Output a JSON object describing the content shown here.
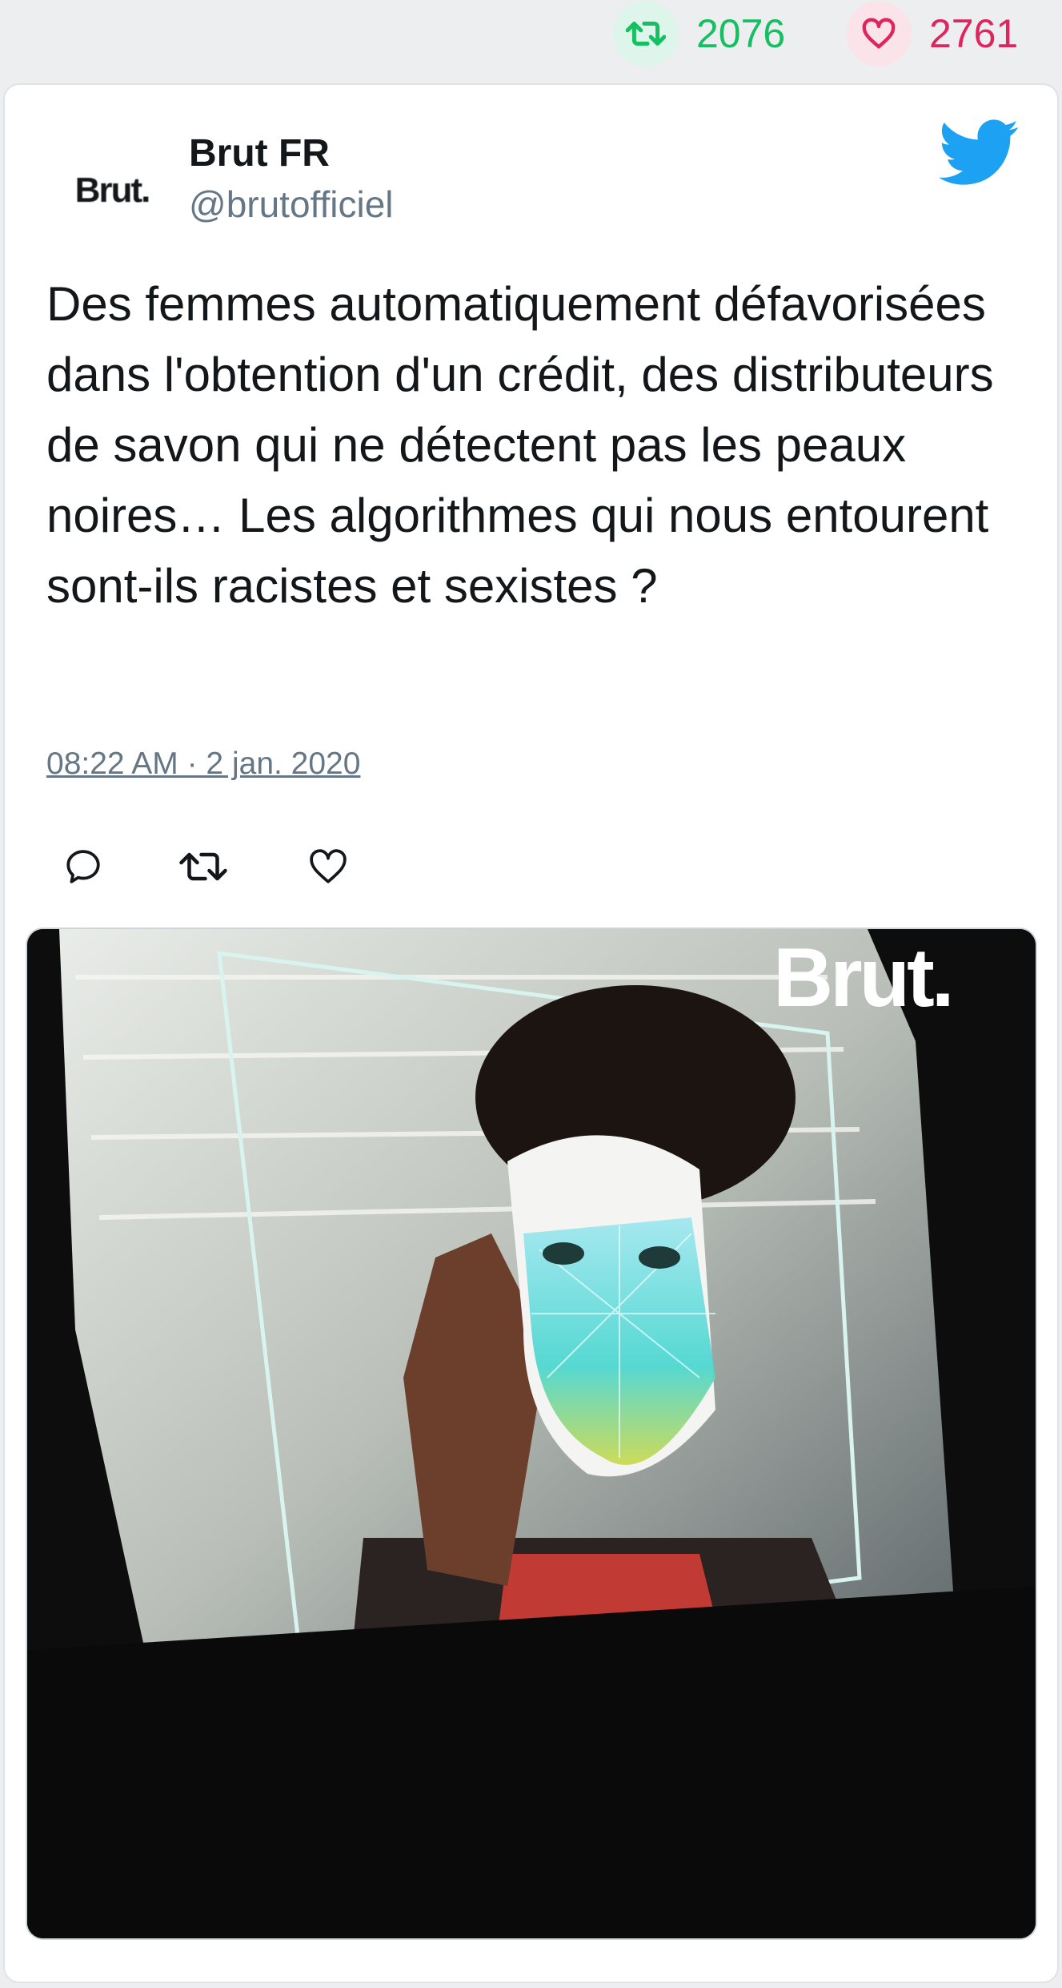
{
  "header_stats": {
    "retweets": "2076",
    "likes": "2761",
    "retweet_icon": "retweet-icon",
    "like_icon": "heart-icon",
    "retweet_color": "#17bf63",
    "like_color": "#e0245e"
  },
  "tweet": {
    "author_avatar_text": "Brut.",
    "author_name": "Brut FR",
    "author_handle": "@brutofficiel",
    "platform_icon": "twitter-bird-icon",
    "text": "Des femmes automatiquement défavorisées dans l'obtention d'un crédit, des distributeurs de savon qui ne détectent pas les peaux noires… Les algorithmes qui nous entourent sont-ils racistes et sexistes ?",
    "timestamp": "08:22 AM · 2 jan. 2020",
    "actions": {
      "reply_icon": "reply-icon",
      "retweet_icon": "retweet-icon",
      "like_icon": "heart-icon"
    },
    "media": {
      "watermark": "Brut."
    }
  },
  "colors": {
    "accent": "#1da1f2",
    "muted_text": "#657786",
    "primary_text": "#14171a"
  }
}
